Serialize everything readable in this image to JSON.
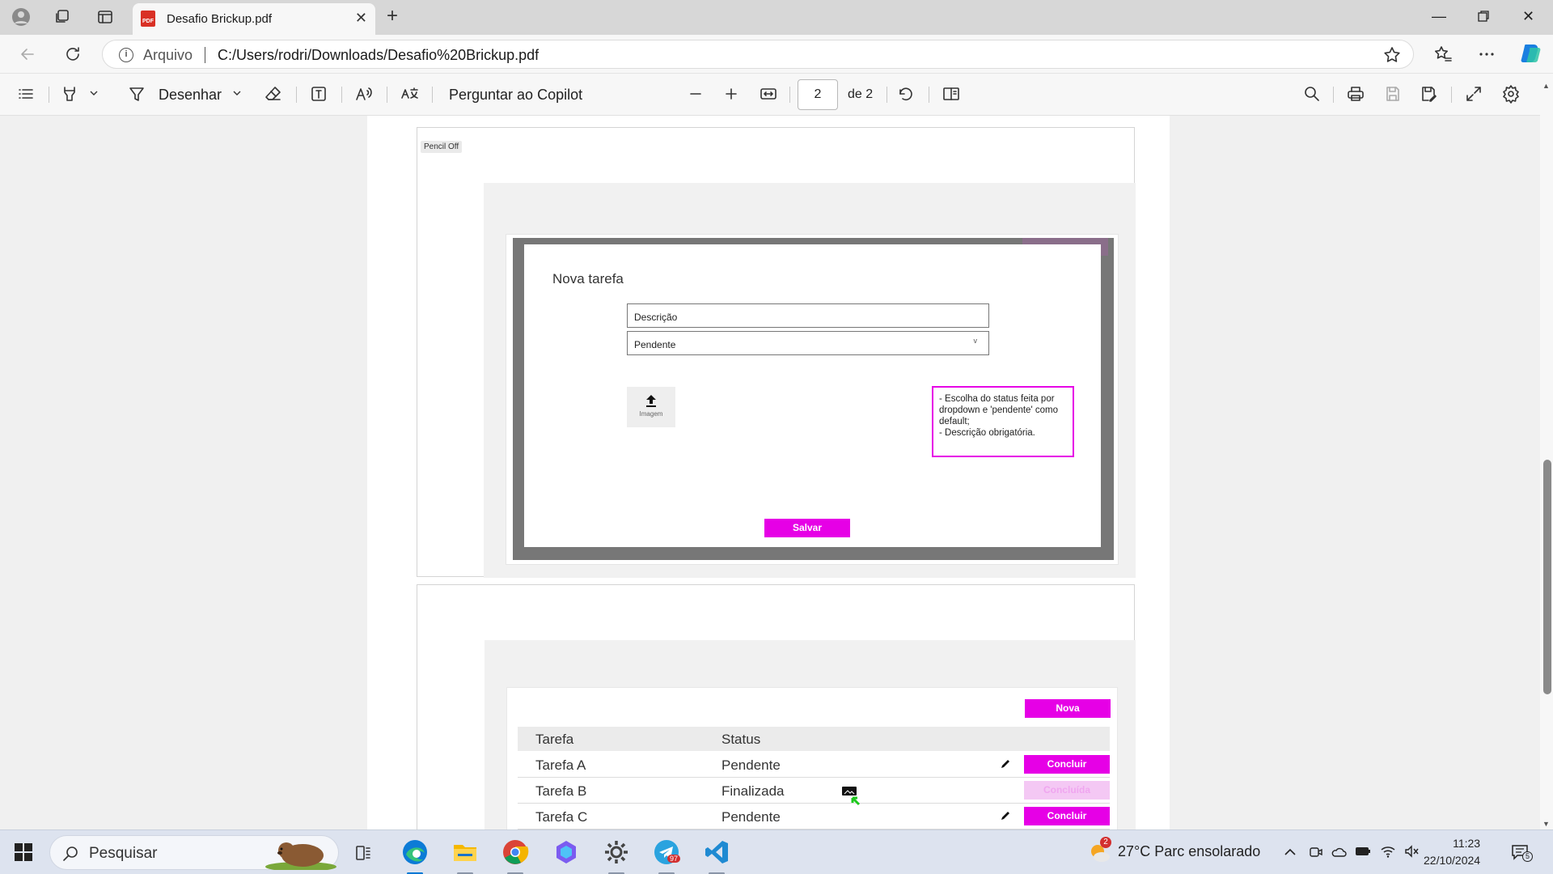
{
  "browser": {
    "tab_title": "Desafio Brickup.pdf",
    "tab_icon_label": "PDF",
    "url_scheme_label": "Arquivo",
    "url": "C:/Users/rodri/Downloads/Desafio%20Brickup.pdf"
  },
  "pdf_toolbar": {
    "draw_label": "Desenhar",
    "copilot_label": "Perguntar ao Copilot",
    "page_number": "2",
    "page_total": "de 2"
  },
  "document": {
    "pencil_off_label": "Pencil Off",
    "modal": {
      "title": "Nova  tarefa",
      "description_placeholder": "Descrição",
      "status_value": "Pendente",
      "status_chevron": "v",
      "upload_label": "Imagem",
      "note_lines": [
        "- Escolha do status feita por dropdown e 'pendente' como default;",
        "- Descrição obrigatória."
      ],
      "save_label": "Salvar"
    },
    "list": {
      "new_label": "Nova",
      "columns": [
        "Tarefa",
        "Status"
      ],
      "rows": [
        {
          "task": "Tarefa A",
          "status": "Pendente",
          "action": "Concluir"
        },
        {
          "task": "Tarefa B",
          "status": "Finalizada",
          "action": "Concluída"
        },
        {
          "task": "Tarefa C",
          "status": "Pendente",
          "action": "Concluir"
        }
      ]
    }
  },
  "taskbar": {
    "search_placeholder": "Pesquisar",
    "weather": "27°C  Parc ensolarado",
    "weather_badge": "2",
    "telegram_badge": "97",
    "time": "11:23",
    "date": "22/10/2024",
    "notification_count": "5"
  },
  "colors": {
    "accent_magenta": "#e600e6",
    "accent_disabled": "#f4c8f4",
    "modal_backdrop": "#777777"
  }
}
